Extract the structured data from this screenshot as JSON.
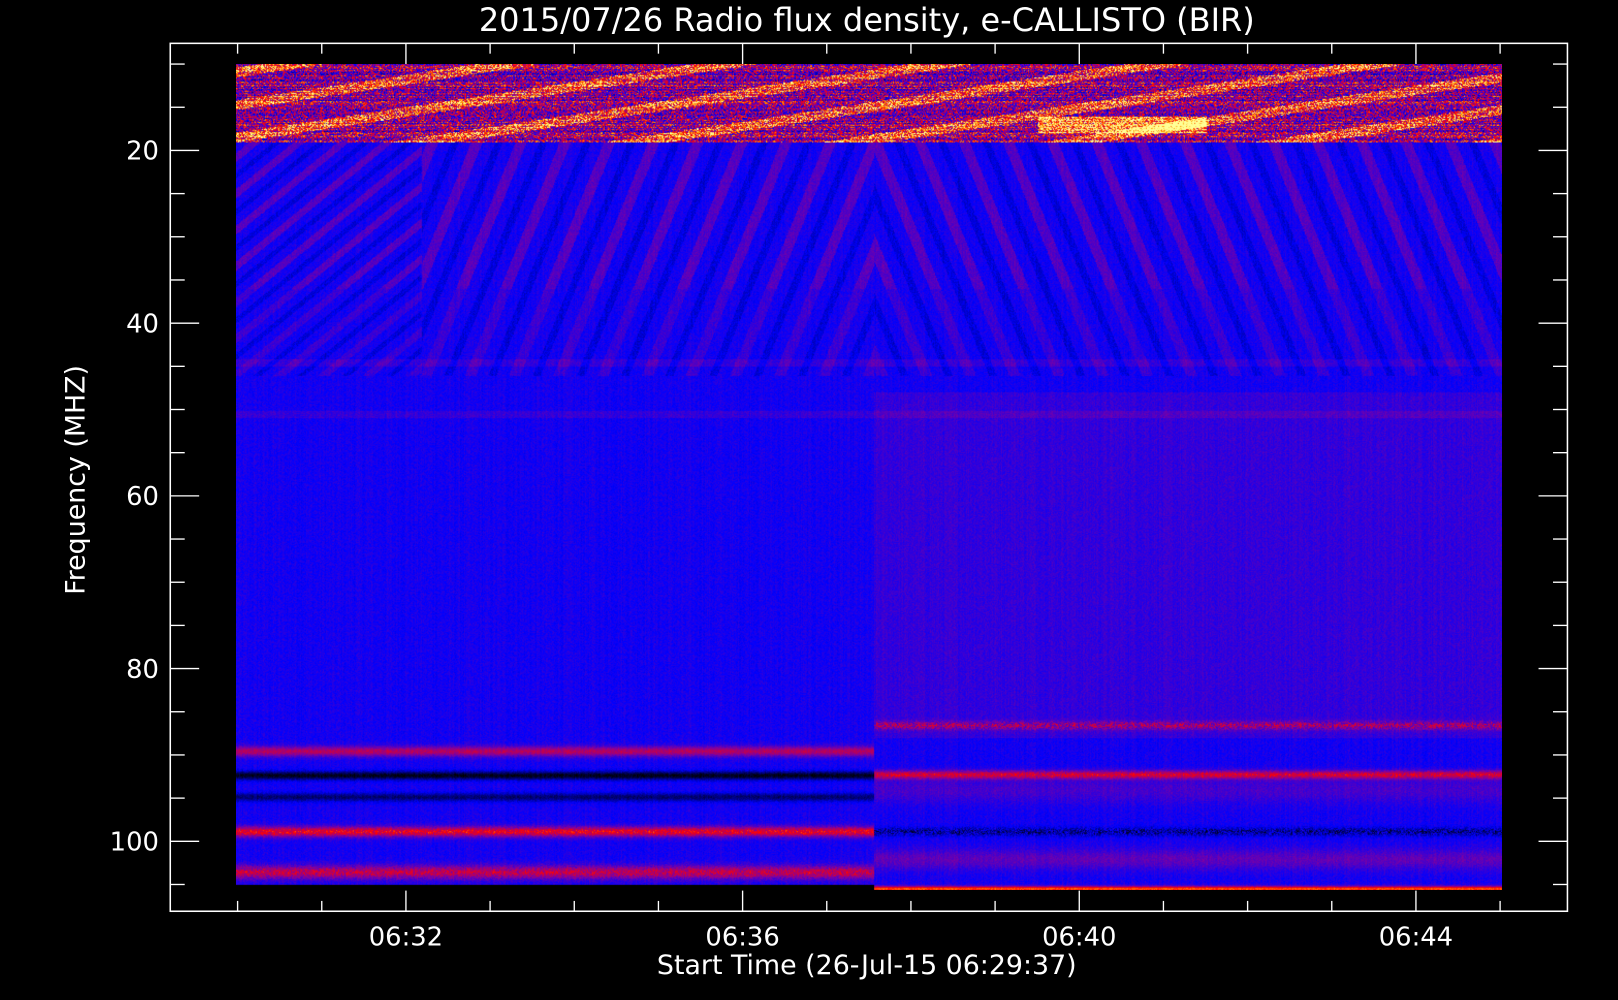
{
  "chart_data": {
    "type": "heatmap",
    "title": "2015/07/26  Radio flux density, e-CALLISTO (BIR)",
    "xlabel": "Start Time (26-Jul-15 06:29:37)",
    "ylabel": "Frequency (MHZ)",
    "x_unit": "minutes after 06:00 UT",
    "xlim": [
      29.2,
      45.8
    ],
    "data_xrange": [
      30.0,
      45.0
    ],
    "ylim": [
      108.1,
      7.6
    ],
    "data_yrange": [
      10.0,
      105.6
    ],
    "y_inverted": true,
    "x_major_ticks": [
      32,
      36,
      40,
      44
    ],
    "x_tick_labels": [
      "06:32",
      "06:36",
      "06:40",
      "06:44"
    ],
    "x_minor_tick_step_min": 1,
    "y_major_ticks": [
      20,
      40,
      60,
      80,
      100
    ],
    "y_tick_labels": [
      "20",
      "40",
      "60",
      "80",
      "100"
    ],
    "y_minor_tick_step": 5,
    "colormap": [
      "#000000",
      "#0000ff",
      "#8000a0",
      "#ff0000",
      "#ffa000",
      "#ffff96"
    ],
    "features": {
      "rfi_band_mhz": [
        10,
        19
      ],
      "drifting_stripes_mhz": [
        20,
        45
      ],
      "receiver_change_time_min": 37.55,
      "left_bands": [
        {
          "f": 89.5,
          "kind": "red"
        },
        {
          "f": 92.3,
          "kind": "black"
        },
        {
          "f": 94.8,
          "kind": "black"
        },
        {
          "f": 98.8,
          "kind": "red"
        },
        {
          "f": 103.5,
          "kind": "red"
        }
      ],
      "right_bands": [
        {
          "f": 86.5,
          "kind": "red"
        },
        {
          "f": 92.2,
          "kind": "red"
        },
        {
          "f": 98.8,
          "kind": "black"
        },
        {
          "f": 105.4,
          "kind": "red"
        }
      ]
    }
  }
}
